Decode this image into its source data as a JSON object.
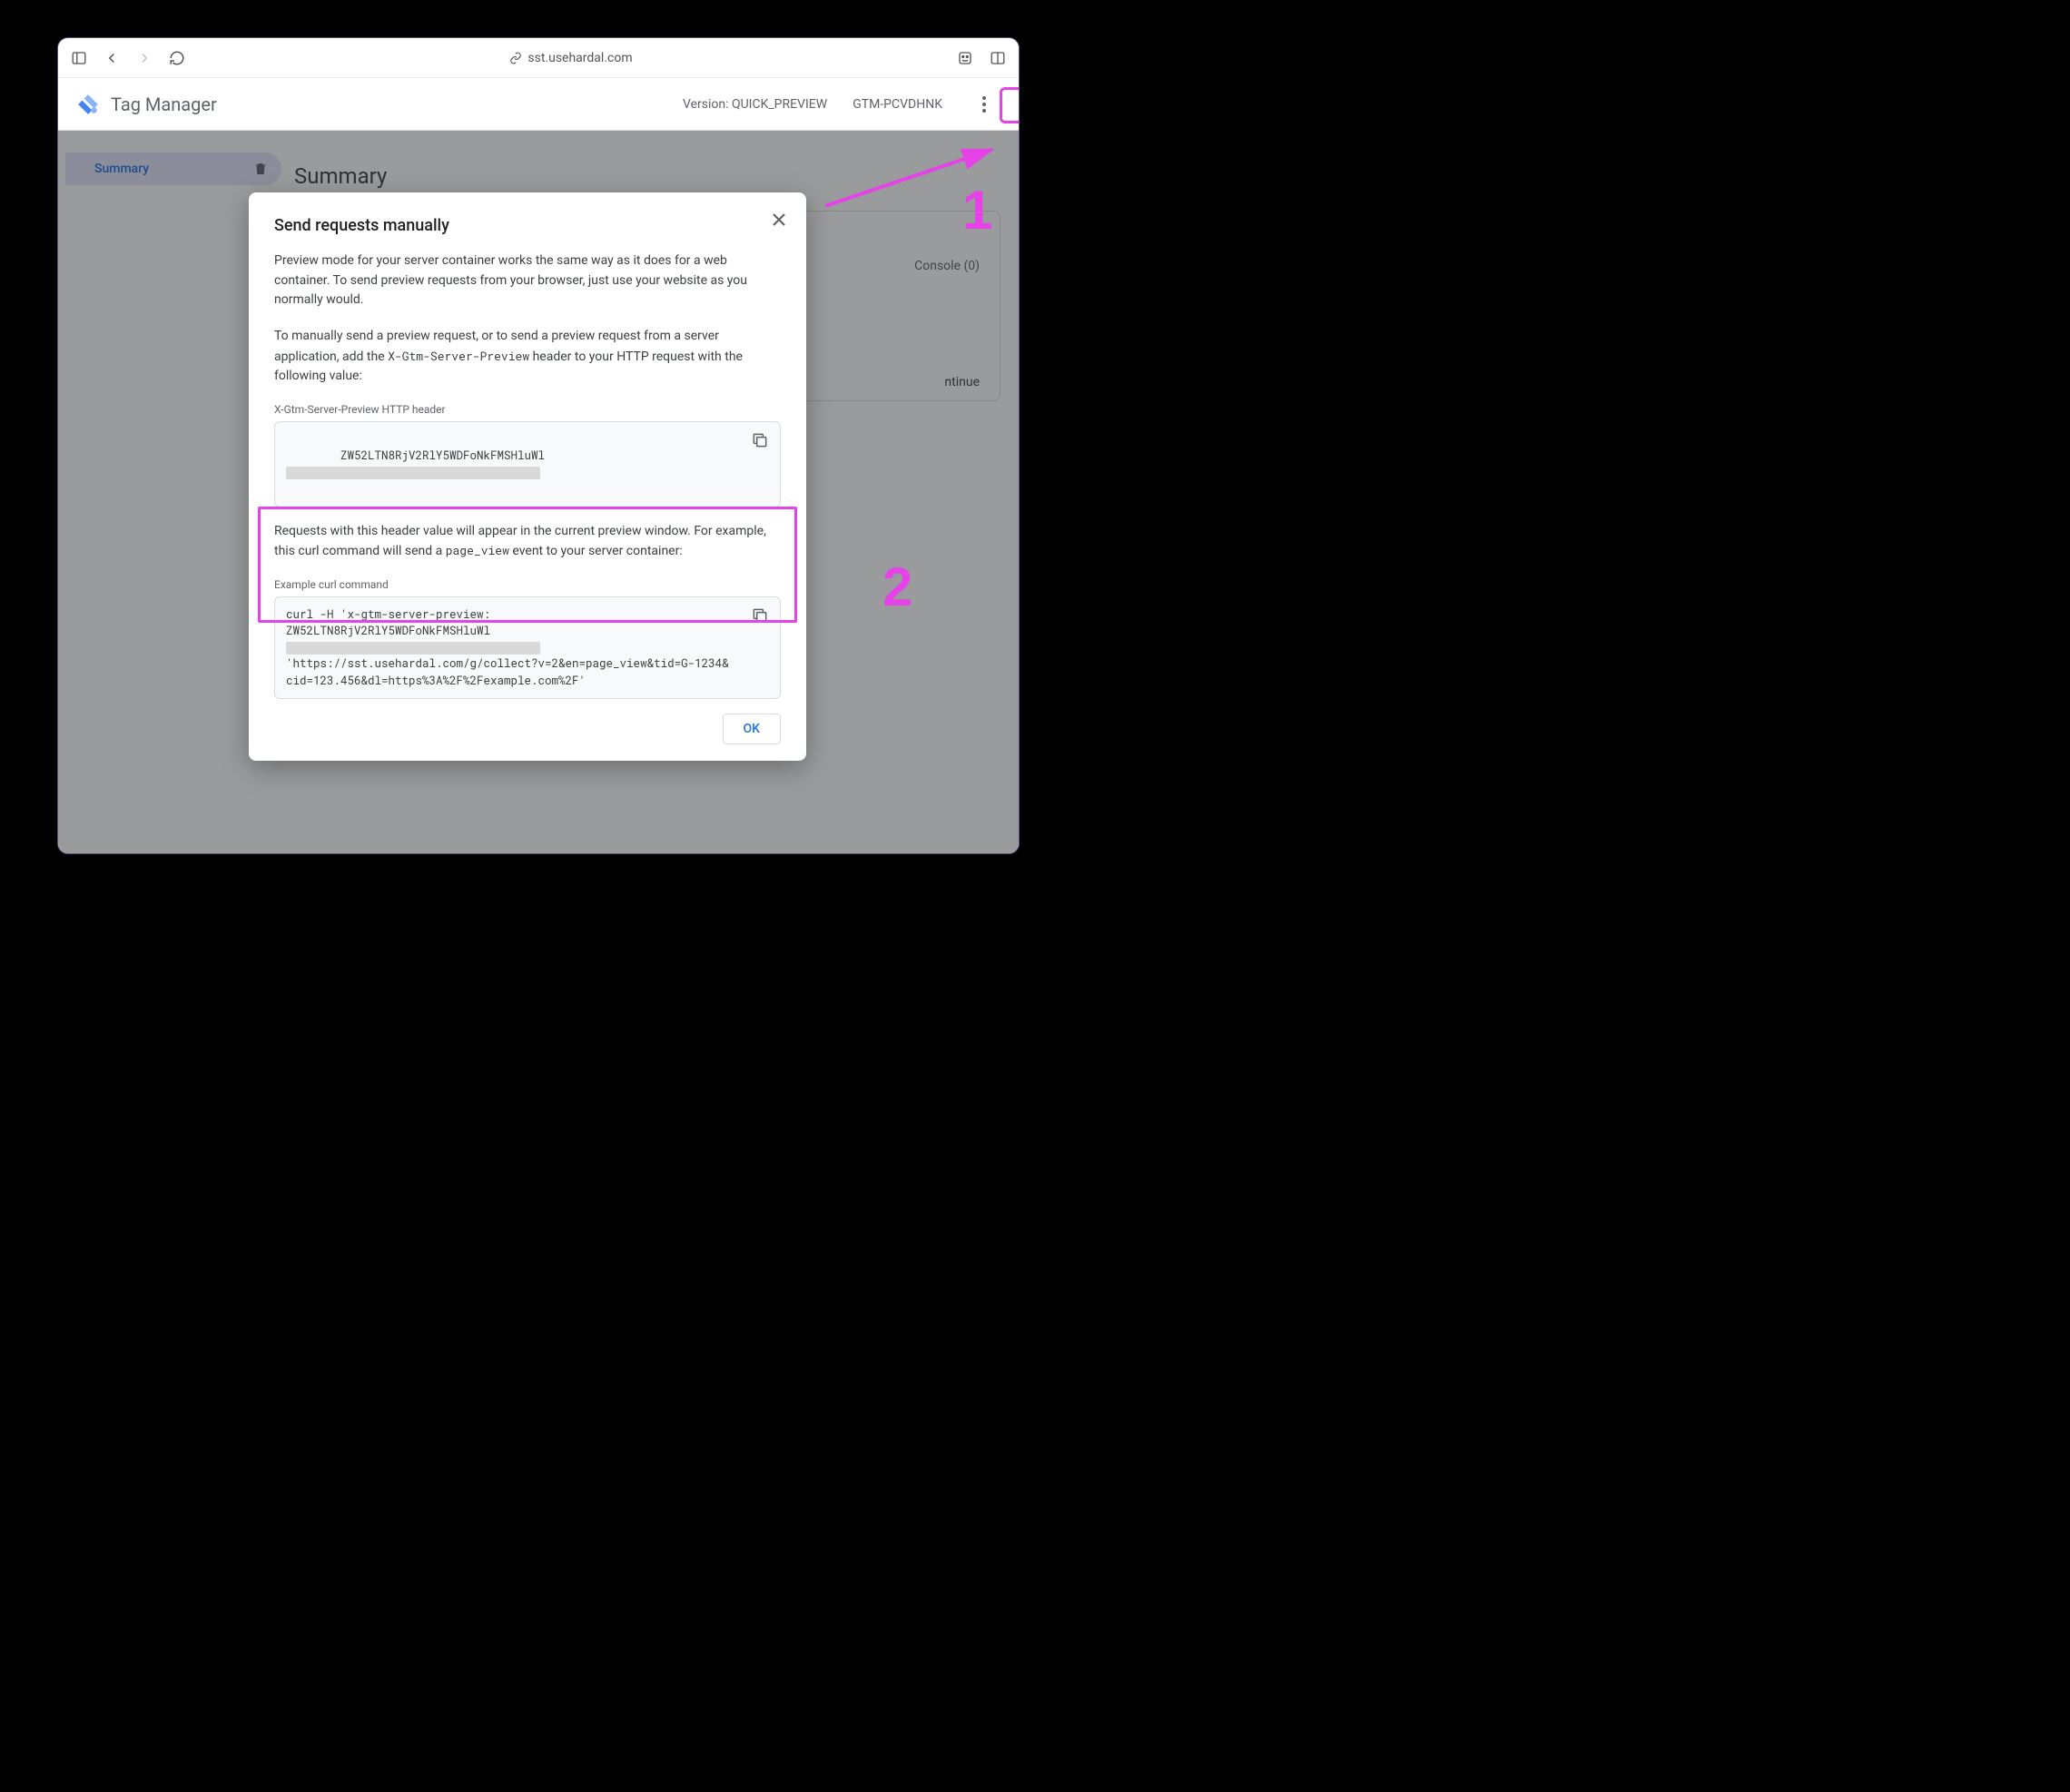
{
  "browser": {
    "url": "sst.usehardal.com"
  },
  "header": {
    "app_title": "Tag Manager",
    "version_label": "Version: QUICK_PREVIEW",
    "container_id": "GTM-PCVDHNK"
  },
  "sidebar": {
    "summary_label": "Summary"
  },
  "main": {
    "title": "Summary",
    "console_tab": "Console (0)",
    "continue_link": "ntinue"
  },
  "modal": {
    "title": "Send requests manually",
    "p1": "Preview mode for your server container works the same way as it does for a web container. To send preview requests from your browser, just use your website as you normally would.",
    "p2_pre": "To manually send a preview request, or to send a preview request from a server application, add the ",
    "p2_code": "X-Gtm-Server-Preview",
    "p2_post": " header to your HTTP request with the following value:",
    "header_label": "X-Gtm-Server-Preview HTTP header",
    "header_value": "ZW52LTN8RjV2RlY5WDFoNkFMSHluWl",
    "p3_pre": "Requests with this header value will appear in the current preview window. For example, this curl command will send a ",
    "p3_code": "page_view",
    "p3_post": " event to your server container:",
    "curl_label": "Example curl command",
    "curl_l1": "curl -H 'x-gtm-server-preview:",
    "curl_l2a": "ZW52LTN8RjV2RlY5WDFoNkFMSHluWl",
    "curl_l3": "'https://sst.usehardal.com/g/collect?v=2&en=page_view&tid=G-1234&cid=123.456&dl=https%3A%2F%2Fexample.com%2F'",
    "ok": "OK"
  },
  "annotations": {
    "n1": "1",
    "n2": "2"
  }
}
